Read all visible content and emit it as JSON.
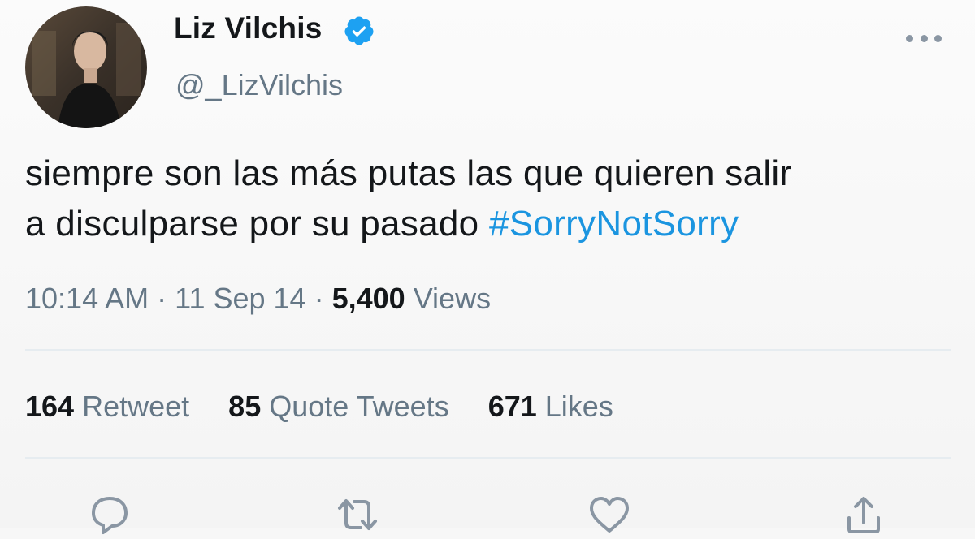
{
  "author": {
    "display_name": "Liz Vilchis",
    "handle": "@_LizVilchis",
    "verified": true,
    "avatar": "profile-photo"
  },
  "tweet": {
    "text_line1": "siempre son las más putas las que quieren salir",
    "text_line2": "a disculparse por su pasado ",
    "hashtag": "#SorryNotSorry"
  },
  "meta": {
    "time": "10:14 AM",
    "separator1": " · ",
    "date": "11 Sep 14",
    "separator2": " · ",
    "views_count": "5,400",
    "views_label": " Views"
  },
  "stats": {
    "retweets_count": "164",
    "retweets_label": " Retweet",
    "quotes_count": "85",
    "quotes_label": " Quote Tweets",
    "likes_count": "671",
    "likes_label": " Likes"
  },
  "actions": [
    {
      "name": "reply",
      "icon": "reply-icon"
    },
    {
      "name": "retweet",
      "icon": "retweet-icon"
    },
    {
      "name": "like",
      "icon": "heart-icon"
    },
    {
      "name": "share",
      "icon": "share-icon"
    }
  ],
  "colors": {
    "link": "#1b95e0",
    "secondary_text": "#657786",
    "primary_text": "#14171a",
    "verified_badge": "#1da1f2",
    "divider": "#e6ecf0"
  }
}
